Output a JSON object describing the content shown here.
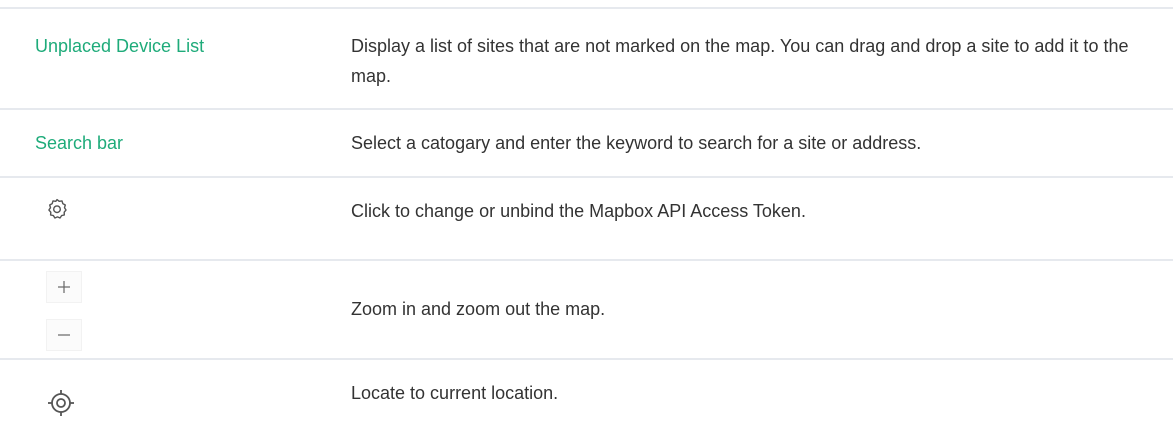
{
  "rows": [
    {
      "term": "Unplaced Device List",
      "description": "Display a list of sites that are not marked on the map. You can drag and drop a site to add it to the map."
    },
    {
      "term": "Search bar",
      "description": "Select a catogary and enter the keyword to search for a site or address."
    },
    {
      "icon": "gear-icon",
      "description": "Click to change or unbind the Mapbox API Access Token."
    },
    {
      "icons": [
        "plus-icon",
        "minus-icon"
      ],
      "description": "Zoom in and zoom out the map."
    },
    {
      "icon": "locate-icon",
      "description": "Locate to current location."
    }
  ],
  "colors": {
    "term": "#1eab7a",
    "text": "#333333",
    "rule": "#e6e9ee"
  }
}
